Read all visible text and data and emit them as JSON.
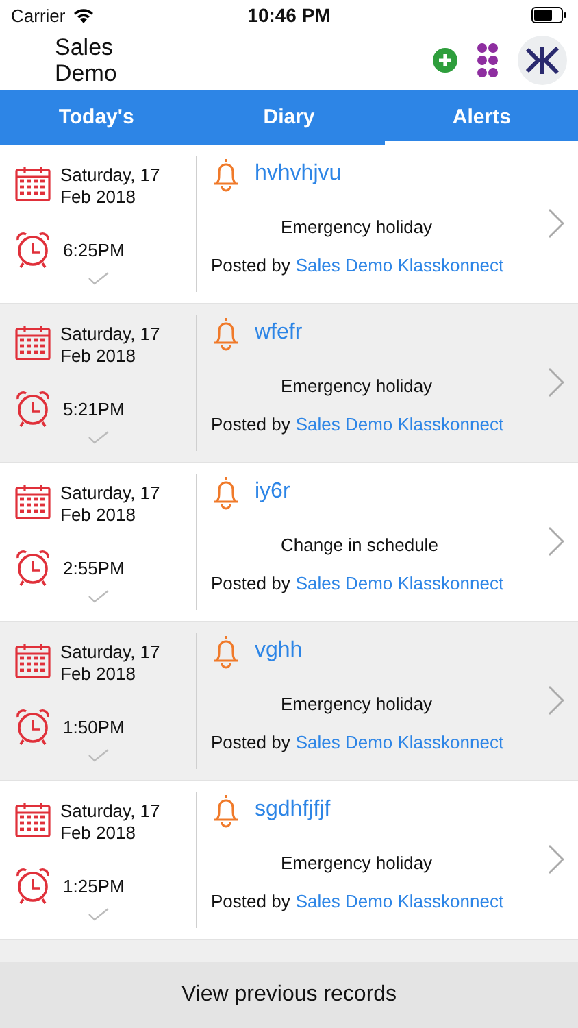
{
  "status_bar": {
    "carrier": "Carrier",
    "time": "10:46 PM"
  },
  "header": {
    "title": "Sales Demo"
  },
  "tabs": [
    {
      "label": "Today's",
      "selected": false
    },
    {
      "label": "Diary",
      "selected": false
    },
    {
      "label": "Alerts",
      "selected": true
    }
  ],
  "alerts": [
    {
      "date": "Saturday, 17 Feb 2018",
      "time": "6:25PM",
      "title": "hvhvhjvu",
      "subject": "Emergency holiday",
      "posted_by": "Posted by",
      "author": "Sales Demo Klasskonnect"
    },
    {
      "date": "Saturday, 17 Feb 2018",
      "time": "5:21PM",
      "title": "wfefr",
      "subject": "Emergency holiday",
      "posted_by": "Posted by",
      "author": "Sales Demo Klasskonnect"
    },
    {
      "date": "Saturday, 17 Feb 2018",
      "time": "2:55PM",
      "title": "iy6r",
      "subject": "Change in schedule",
      "posted_by": "Posted by",
      "author": "Sales Demo Klasskonnect"
    },
    {
      "date": "Saturday, 17 Feb 2018",
      "time": "1:50PM",
      "title": "vghh",
      "subject": "Emergency holiday",
      "posted_by": "Posted by",
      "author": "Sales Demo Klasskonnect"
    },
    {
      "date": "Saturday, 17 Feb 2018",
      "time": "1:25PM",
      "title": "sgdhfjfjf",
      "subject": "Emergency holiday",
      "posted_by": "Posted by",
      "author": "Sales Demo Klasskonnect"
    }
  ],
  "footer_button": "View previous records"
}
